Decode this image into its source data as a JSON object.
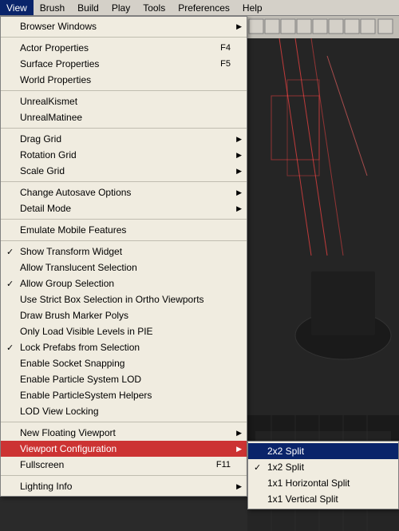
{
  "menubar": {
    "items": [
      {
        "id": "view",
        "label": "View",
        "active": true
      },
      {
        "id": "brush",
        "label": "Brush",
        "active": false
      },
      {
        "id": "build",
        "label": "Build",
        "active": false
      },
      {
        "id": "play",
        "label": "Play",
        "active": false
      },
      {
        "id": "tools",
        "label": "Tools",
        "active": false
      },
      {
        "id": "preferences",
        "label": "Preferences",
        "active": false
      },
      {
        "id": "help",
        "label": "Help",
        "active": false
      }
    ]
  },
  "view_menu": {
    "items": [
      {
        "id": "browser-windows",
        "label": "Browser Windows",
        "type": "submenu",
        "shortcut": ""
      },
      {
        "id": "sep1",
        "type": "separator"
      },
      {
        "id": "actor-properties",
        "label": "Actor Properties",
        "type": "item",
        "shortcut": "F4"
      },
      {
        "id": "surface-properties",
        "label": "Surface Properties",
        "type": "item",
        "shortcut": "F5"
      },
      {
        "id": "world-properties",
        "label": "World Properties",
        "type": "item",
        "shortcut": ""
      },
      {
        "id": "sep2",
        "type": "separator"
      },
      {
        "id": "unrealkismet",
        "label": "UnrealKismet",
        "type": "item",
        "shortcut": ""
      },
      {
        "id": "unrealmatinee",
        "label": "UnrealMatinee",
        "type": "item",
        "shortcut": ""
      },
      {
        "id": "sep3",
        "type": "separator"
      },
      {
        "id": "drag-grid",
        "label": "Drag Grid",
        "type": "submenu",
        "shortcut": ""
      },
      {
        "id": "rotation-grid",
        "label": "Rotation Grid",
        "type": "submenu",
        "shortcut": ""
      },
      {
        "id": "scale-grid",
        "label": "Scale Grid",
        "type": "submenu",
        "shortcut": ""
      },
      {
        "id": "sep4",
        "type": "separator"
      },
      {
        "id": "change-autosave",
        "label": "Change Autosave Options",
        "type": "submenu",
        "shortcut": ""
      },
      {
        "id": "detail-mode",
        "label": "Detail Mode",
        "type": "submenu",
        "shortcut": ""
      },
      {
        "id": "sep5",
        "type": "separator"
      },
      {
        "id": "emulate-mobile",
        "label": "Emulate Mobile Features",
        "type": "item",
        "shortcut": ""
      },
      {
        "id": "sep6",
        "type": "separator"
      },
      {
        "id": "show-transform",
        "label": "Show Transform Widget",
        "type": "checkitem",
        "checked": true,
        "shortcut": ""
      },
      {
        "id": "allow-translucent",
        "label": "Allow Translucent Selection",
        "type": "checkitem",
        "checked": false,
        "shortcut": ""
      },
      {
        "id": "allow-group",
        "label": "Allow Group Selection",
        "type": "checkitem",
        "checked": true,
        "shortcut": ""
      },
      {
        "id": "strict-box",
        "label": "Use Strict Box Selection in Ortho Viewports",
        "type": "checkitem",
        "checked": false,
        "shortcut": ""
      },
      {
        "id": "draw-brush",
        "label": "Draw Brush Marker Polys",
        "type": "checkitem",
        "checked": false,
        "shortcut": ""
      },
      {
        "id": "only-load",
        "label": "Only Load Visible Levels in PIE",
        "type": "checkitem",
        "checked": false,
        "shortcut": ""
      },
      {
        "id": "lock-prefabs",
        "label": "Lock Prefabs from Selection",
        "type": "checkitem",
        "checked": true,
        "shortcut": ""
      },
      {
        "id": "enable-socket",
        "label": "Enable Socket Snapping",
        "type": "checkitem",
        "checked": false,
        "shortcut": ""
      },
      {
        "id": "enable-particle-lod",
        "label": "Enable Particle System LOD",
        "type": "checkitem",
        "checked": false,
        "shortcut": ""
      },
      {
        "id": "enable-particle-helpers",
        "label": "Enable ParticleSystem Helpers",
        "type": "checkitem",
        "checked": false,
        "shortcut": ""
      },
      {
        "id": "lod-view-locking",
        "label": "LOD View Locking",
        "type": "checkitem",
        "checked": false,
        "shortcut": ""
      },
      {
        "id": "sep7",
        "type": "separator"
      },
      {
        "id": "new-floating",
        "label": "New Floating Viewport",
        "type": "submenu",
        "shortcut": ""
      },
      {
        "id": "viewport-config",
        "label": "Viewport Configuration",
        "type": "submenu_active",
        "shortcut": ""
      },
      {
        "id": "fullscreen",
        "label": "Fullscreen",
        "type": "item",
        "shortcut": "F11"
      },
      {
        "id": "sep8",
        "type": "separator"
      },
      {
        "id": "lighting-info",
        "label": "Lighting Info",
        "type": "submenu",
        "shortcut": ""
      }
    ]
  },
  "viewport_submenu": {
    "items": [
      {
        "id": "2x2-split",
        "label": "2x2 Split",
        "highlighted": true,
        "checked": false
      },
      {
        "id": "1x2-split",
        "label": "1x2 Split",
        "highlighted": false,
        "checked": true
      },
      {
        "id": "1x1-horizontal",
        "label": "1x1 Horizontal Split",
        "highlighted": false,
        "checked": false
      },
      {
        "id": "1x1-vertical",
        "label": "1x1 Vertical Split",
        "highlighted": false,
        "checked": false
      }
    ]
  }
}
